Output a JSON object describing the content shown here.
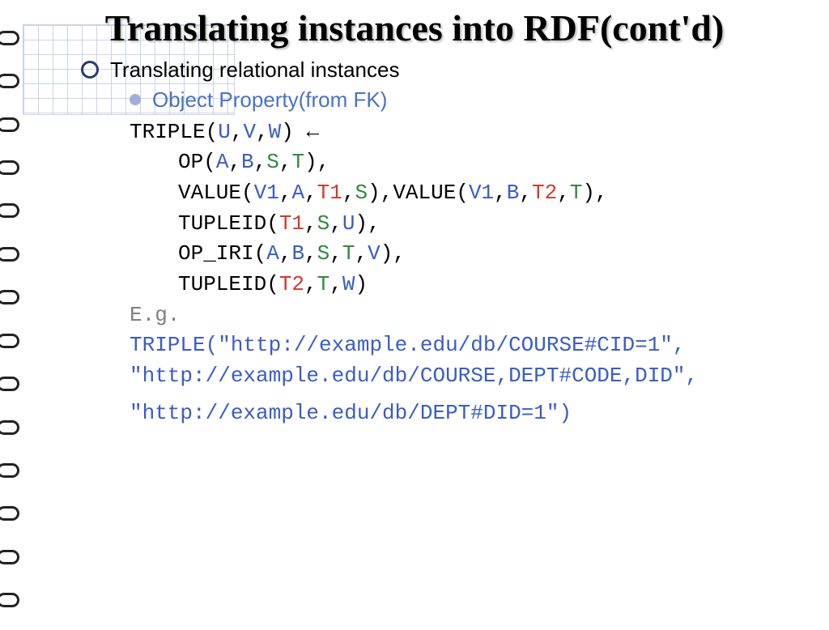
{
  "title": "Translating instances into RDF(cont'd)",
  "bullet1": "Translating relational instances",
  "bullet2": "Object Property(from FK)",
  "code": {
    "l1a": "TRIPLE(",
    "l1_U": "U",
    "l1_c1": ",",
    "l1_V": "V",
    "l1_c2": ",",
    "l1_W": "W",
    "l1b": ") ←",
    "l2a": "OP(",
    "l2_A": "A",
    "l2_c1": ",",
    "l2_B": "B",
    "l2_c2": ",",
    "l2_S": "S",
    "l2_c3": ",",
    "l2_T": "T",
    "l2b": "),",
    "l3a": "VALUE(",
    "l3_V1a": "V1",
    "l3_c1": ",",
    "l3_A": "A",
    "l3_c2": ",",
    "l3_T1": "T1",
    "l3_c3": ",",
    "l3_S": "S",
    "l3b": "),VALUE(",
    "l3_V1b": "V1",
    "l3_c4": ",",
    "l3_B": "B",
    "l3_c5": ",",
    "l3_T2": "T2",
    "l3_c6": ",",
    "l3_T": "T",
    "l3c": "),",
    "l4a": "TUPLEID(",
    "l4_T1": "T1",
    "l4_c1": ",",
    "l4_S": "S",
    "l4_c2": ",",
    "l4_U": "U",
    "l4b": "),",
    "l5a": "OP_IRI(",
    "l5_A": "A",
    "l5_c1": ",",
    "l5_B": "B",
    "l5_c2": ",",
    "l5_S": "S",
    "l5_c3": ",",
    "l5_T": "T",
    "l5_c4": ",",
    "l5_V": "V",
    "l5b": "),",
    "l6a": "TUPLEID(",
    "l6_T2": "T2",
    "l6_c1": ",",
    "l6_T": "T",
    "l6_c2": ",",
    "l6_W": "W",
    "l6b": ")"
  },
  "eg_label": "E.g.",
  "example": {
    "e1": "TRIPLE(\"http://example.edu/db/COURSE#CID=1\",",
    "e2": "\"http://example.edu/db/COURSE,DEPT#CODE,DID\",",
    "e3": "\"http://example.edu/db/DEPT#DID=1\")"
  }
}
